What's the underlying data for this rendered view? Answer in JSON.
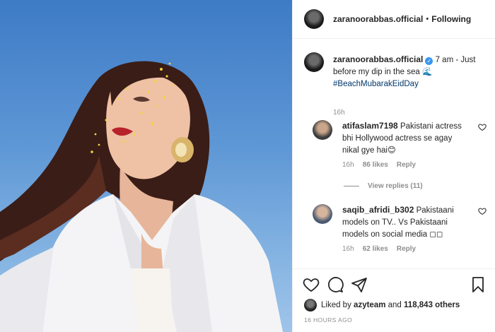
{
  "post": {
    "username": "zaranoorabbas.official",
    "follow_label": "Following",
    "separator": "•"
  },
  "caption": {
    "username": "zaranoorabbas.official",
    "text": "7 am - Just before my dip in the sea",
    "wave": "🌊",
    "hashtag": "#BeachMubarakEidDay",
    "time": "16h"
  },
  "comments": [
    {
      "username": "atifaslam7198",
      "text": "Pakistani actress bhi Hollywood actress se agay nikal gye hai😊",
      "time": "16h",
      "likes": "86 likes",
      "reply_label": "Reply",
      "view_replies": "View replies (11)"
    },
    {
      "username": "saqib_afridi_b302",
      "text": "Pakistaani models on TV.. Vs Pakistaani models on social media ◻◻",
      "time": "16h",
      "likes": "62 likes",
      "reply_label": "Reply"
    }
  ],
  "likes": {
    "prefix": "Liked by",
    "user": "azyteam",
    "and": "and",
    "count": "118,843 others"
  },
  "posted_ago": "16 HOURS AGO",
  "colors": {
    "verified": "#3897f0",
    "hashtag": "#00376b",
    "muted": "#8e8e8e"
  },
  "icons": [
    "heart-icon",
    "comment-icon",
    "share-icon",
    "bookmark-icon",
    "verified-icon"
  ]
}
